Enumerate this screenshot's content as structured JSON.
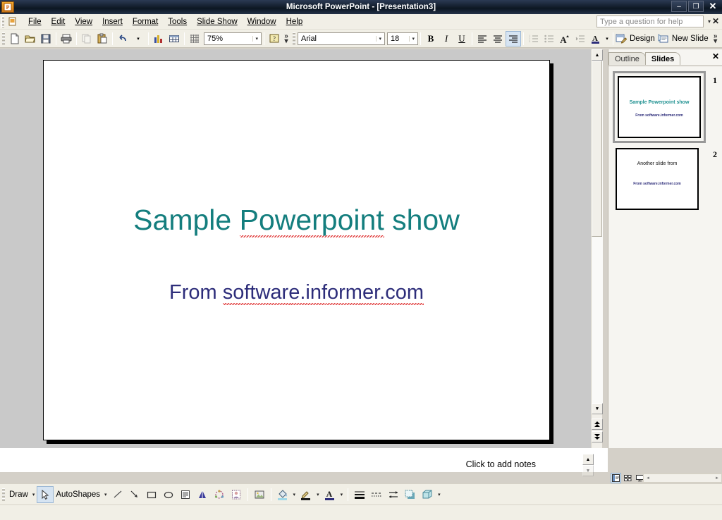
{
  "window": {
    "title": "Microsoft PowerPoint - [Presentation3]",
    "app_icon": "powerpoint-icon",
    "minimize": "–",
    "restore": "❐",
    "close": "✕"
  },
  "menubar": {
    "items": [
      {
        "label": "File"
      },
      {
        "label": "Edit"
      },
      {
        "label": "View"
      },
      {
        "label": "Insert"
      },
      {
        "label": "Format"
      },
      {
        "label": "Tools"
      },
      {
        "label": "Slide Show"
      },
      {
        "label": "Window"
      },
      {
        "label": "Help"
      }
    ],
    "help_placeholder": "Type a question for help",
    "close_label": "✕"
  },
  "toolbar": {
    "zoom_value": "75%",
    "font_name": "Arial",
    "font_size": "18",
    "bold_label": "B",
    "italic_label": "I",
    "underline_label": "U",
    "design_label": "Design",
    "new_slide_label": "New Slide",
    "overflow_label": "»",
    "buttons": [
      {
        "name": "new-document-icon"
      },
      {
        "name": "open-folder-icon"
      },
      {
        "name": "save-icon"
      },
      {
        "name": "print-icon"
      },
      {
        "name": "copy-icon"
      },
      {
        "name": "paste-icon"
      },
      {
        "name": "undo-icon"
      },
      {
        "name": "insert-chart-icon"
      },
      {
        "name": "insert-table-icon"
      },
      {
        "name": "show-grid-icon"
      },
      {
        "name": "help-icon"
      },
      {
        "name": "increase-font-size-icon"
      },
      {
        "name": "font-color-icon"
      }
    ]
  },
  "slide_pane": {
    "tabs": [
      {
        "label": "Outline",
        "active": false
      },
      {
        "label": "Slides",
        "active": true
      }
    ],
    "close_label": "✕",
    "thumbnails": [
      {
        "number": "1",
        "title": "Sample Powerpoint show",
        "subtitle": "From software.informer.com",
        "selected": true
      },
      {
        "number": "2",
        "title": "Another slide from",
        "subtitle": "From software.informer.com",
        "selected": false
      }
    ]
  },
  "slide": {
    "title_part1": "Sample ",
    "title_part2": "Powerpoint",
    "title_part3": " show",
    "subtitle_part1": "From ",
    "subtitle_part2": "software.informer.com",
    "title_color": "#147e7e",
    "subtitle_color": "#2d2d7a"
  },
  "notes": {
    "placeholder": "Click to add notes"
  },
  "drawing_toolbar": {
    "draw_label": "Draw",
    "autoshapes_label": "AutoShapes",
    "caret": "▾",
    "buttons": [
      {
        "name": "select-arrow-icon"
      },
      {
        "name": "line-icon"
      },
      {
        "name": "arrow-icon"
      },
      {
        "name": "rectangle-icon"
      },
      {
        "name": "oval-icon"
      },
      {
        "name": "text-box-icon"
      },
      {
        "name": "wordart-icon"
      },
      {
        "name": "diagram-icon"
      },
      {
        "name": "clip-art-icon"
      },
      {
        "name": "insert-picture-icon"
      },
      {
        "name": "fill-color-icon"
      },
      {
        "name": "line-color-icon"
      },
      {
        "name": "font-color-icon"
      },
      {
        "name": "line-style-icon"
      },
      {
        "name": "dash-style-icon"
      },
      {
        "name": "arrow-style-icon"
      },
      {
        "name": "shadow-style-icon"
      },
      {
        "name": "3d-style-icon"
      }
    ]
  },
  "view_buttons": [
    {
      "name": "normal-view-button",
      "active": true
    },
    {
      "name": "slide-sorter-view-button",
      "active": false
    },
    {
      "name": "slide-show-button",
      "active": false
    }
  ],
  "scrollbars": {
    "up_arrow": "▲",
    "down_arrow": "▼",
    "previous_slide": "▲",
    "next_slide": "▼",
    "left_arrow": "◄",
    "right_arrow": "►"
  }
}
